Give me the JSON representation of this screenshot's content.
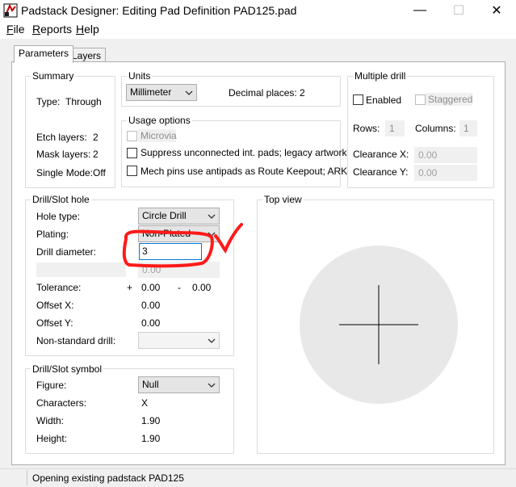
{
  "window": {
    "title": "Padstack Designer: Editing Pad Definition PAD125.pad",
    "minimize": "—",
    "maximize": "☐",
    "close": "✕"
  },
  "menu": [
    {
      "label": "File",
      "underline": "F",
      "rest": "ile"
    },
    {
      "label": "Reports",
      "underline": "R",
      "rest": "eports"
    },
    {
      "label": "Help",
      "underline": "H",
      "rest": "elp"
    }
  ],
  "tabs": [
    "Parameters",
    "Layers"
  ],
  "summary": {
    "title": "Summary",
    "type_label": "Type:",
    "type_value": "Through",
    "etch_label": "Etch layers:",
    "etch_value": "2",
    "mask_label": "Mask layers:",
    "mask_value": "2",
    "single_label": "Single Mode:",
    "single_value": "Off"
  },
  "units": {
    "title": "Units",
    "unit_value": "Millimeter",
    "decimal_label": "Decimal places:",
    "decimal_value": "2"
  },
  "usage": {
    "title": "Usage options",
    "microvia": "Microvia",
    "suppress": "Suppress unconnected int. pads; legacy artwork",
    "mech": "Mech pins use antipads as Route Keepout; ARK"
  },
  "multi": {
    "title": "Multiple drill",
    "enabled": "Enabled",
    "staggered": "Staggered",
    "rows_label": "Rows:",
    "rows_value": "1",
    "cols_label": "Columns:",
    "cols_value": "1",
    "clx_label": "Clearance X:",
    "clx_value": "0.00",
    "cly_label": "Clearance Y:",
    "cly_value": "0.00"
  },
  "drill": {
    "title": "Drill/Slot hole",
    "hole_type_label": "Hole type:",
    "hole_type_value": "Circle Drill",
    "plating_label": "Plating:",
    "plating_value": "Non-Plated",
    "diameter_label": "Drill diameter:",
    "diameter_value": "3",
    "slot_value": "0.00",
    "tol_label": "Tolerance:",
    "tol_plus": "+",
    "tol_plus_value": "0.00",
    "tol_minus": "-",
    "tol_minus_value": "0.00",
    "offx_label": "Offset X:",
    "offx_value": "0.00",
    "offy_label": "Offset Y:",
    "offy_value": "0.00",
    "nonstd_label": "Non-standard drill:"
  },
  "symbol": {
    "title": "Drill/Slot symbol",
    "figure_label": "Figure:",
    "figure_value": "Null",
    "chars_label": "Characters:",
    "chars_value": "X",
    "width_label": "Width:",
    "width_value": "1.90",
    "height_label": "Height:",
    "height_value": "1.90"
  },
  "topview": {
    "title": "Top view"
  },
  "status": {
    "text": "Opening existing padstack PAD125"
  },
  "colors": {
    "annotation": "#ff1a1a",
    "input_focus": "#0078d7"
  }
}
